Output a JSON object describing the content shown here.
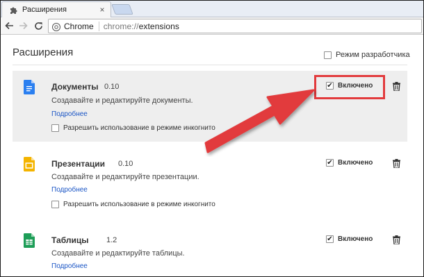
{
  "browser": {
    "tab_title": "Расширения",
    "tab_close": "×",
    "address_chip": "Chrome",
    "url_scheme": "chrome://",
    "url_path": "extensions"
  },
  "page": {
    "title": "Расширения",
    "developer_mode_label": "Режим разработчика"
  },
  "extensions": [
    {
      "name": "Документы",
      "version": "0.10",
      "description": "Создавайте и редактируйте документы.",
      "details_link": "Подробнее",
      "incognito_label": "Разрешить использование в режиме инкогнито",
      "enabled_label": "Включено",
      "enabled": true,
      "icon": "google-docs-icon",
      "color": "#2a7ff0"
    },
    {
      "name": "Презентации",
      "version": "0.10",
      "description": "Создавайте и редактируйте презентации.",
      "details_link": "Подробнее",
      "incognito_label": "Разрешить использование в режиме инкогнито",
      "enabled_label": "Включено",
      "enabled": true,
      "icon": "google-slides-icon",
      "color": "#f4b400"
    },
    {
      "name": "Таблицы",
      "version": "1.2",
      "description": "Создавайте и редактируйте таблицы.",
      "details_link": "Подробнее",
      "enabled_label": "Включено",
      "enabled": true,
      "icon": "google-sheets-icon",
      "color": "#1e9e58"
    }
  ],
  "annotation": {
    "highlight_color": "#e23a3c"
  }
}
